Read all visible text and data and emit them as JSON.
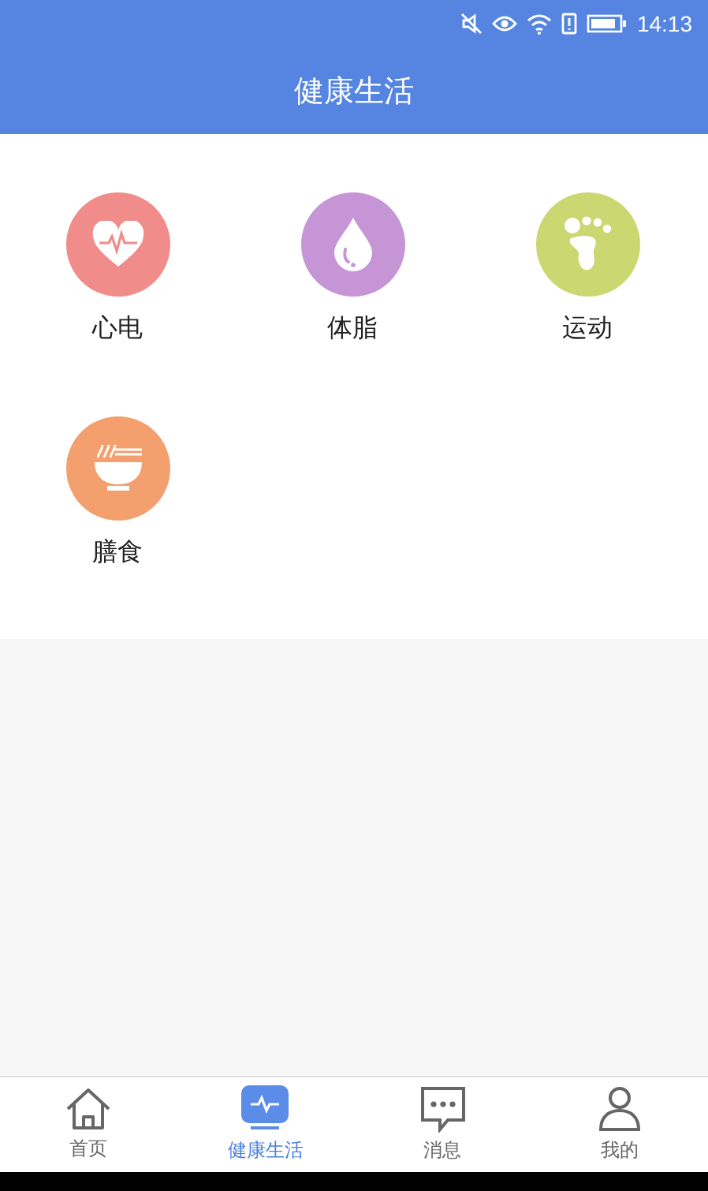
{
  "status_bar": {
    "time": "14:13"
  },
  "header": {
    "title": "健康生活"
  },
  "features": [
    {
      "label": "心电",
      "kind": "heart",
      "color": "#f08c8a"
    },
    {
      "label": "体脂",
      "kind": "drop",
      "color": "#c595d6"
    },
    {
      "label": "运动",
      "kind": "foot",
      "color": "#cbd872"
    },
    {
      "label": "膳食",
      "kind": "bowl",
      "color": "#f3a06e"
    }
  ],
  "tab_bar": [
    {
      "label": "首页",
      "kind": "home",
      "selected": false
    },
    {
      "label": "健康生活",
      "kind": "health",
      "selected": true
    },
    {
      "label": "消息",
      "kind": "message",
      "selected": false
    },
    {
      "label": "我的",
      "kind": "profile",
      "selected": false
    }
  ]
}
